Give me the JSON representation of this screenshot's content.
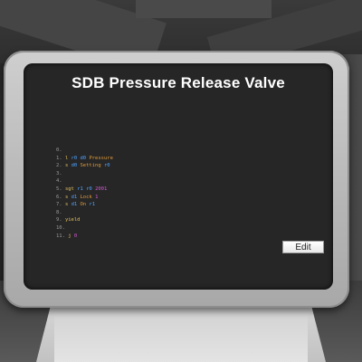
{
  "screen": {
    "title": "SDB Pressure Release Valve",
    "edit_label": "Edit"
  },
  "code": {
    "lines": [
      {
        "tokens": [
          {
            "text": "0.",
            "color": "#9a9a9a"
          }
        ]
      },
      {
        "tokens": [
          {
            "text": "1. ",
            "color": "#9a9a9a"
          },
          {
            "text": "l ",
            "color": "#e0c060"
          },
          {
            "text": "r0 ",
            "color": "#4fa3ff"
          },
          {
            "text": "d0 ",
            "color": "#4fa3ff"
          },
          {
            "text": "Pressure",
            "color": "#e09a3a"
          }
        ]
      },
      {
        "tokens": [
          {
            "text": "2. ",
            "color": "#9a9a9a"
          },
          {
            "text": "s ",
            "color": "#e0c060"
          },
          {
            "text": "d0 ",
            "color": "#4fa3ff"
          },
          {
            "text": "Setting ",
            "color": "#e09a3a"
          },
          {
            "text": "r0",
            "color": "#4fa3ff"
          }
        ]
      },
      {
        "tokens": [
          {
            "text": "3.",
            "color": "#9a9a9a"
          }
        ]
      },
      {
        "tokens": [
          {
            "text": "4.",
            "color": "#9a9a9a"
          }
        ]
      },
      {
        "tokens": [
          {
            "text": "5. ",
            "color": "#9a9a9a"
          },
          {
            "text": "sgt ",
            "color": "#e0c060"
          },
          {
            "text": "r1 ",
            "color": "#4fa3ff"
          },
          {
            "text": "r0 ",
            "color": "#4fa3ff"
          },
          {
            "text": "2001",
            "color": "#d05ad0"
          }
        ]
      },
      {
        "tokens": [
          {
            "text": "6. ",
            "color": "#9a9a9a"
          },
          {
            "text": "s ",
            "color": "#e0c060"
          },
          {
            "text": "d1 ",
            "color": "#4fa3ff"
          },
          {
            "text": "Lock ",
            "color": "#e09a3a"
          },
          {
            "text": "1",
            "color": "#d05ad0"
          }
        ]
      },
      {
        "tokens": [
          {
            "text": "7. ",
            "color": "#9a9a9a"
          },
          {
            "text": "s ",
            "color": "#e0c060"
          },
          {
            "text": "d1 ",
            "color": "#4fa3ff"
          },
          {
            "text": "On ",
            "color": "#e09a3a"
          },
          {
            "text": "r1",
            "color": "#4fa3ff"
          }
        ]
      },
      {
        "tokens": [
          {
            "text": "8.",
            "color": "#9a9a9a"
          }
        ]
      },
      {
        "tokens": [
          {
            "text": "9. ",
            "color": "#9a9a9a"
          },
          {
            "text": "yield",
            "color": "#e0c060"
          }
        ]
      },
      {
        "tokens": [
          {
            "text": "10.",
            "color": "#9a9a9a"
          }
        ]
      },
      {
        "tokens": [
          {
            "text": "11. ",
            "color": "#9a9a9a"
          },
          {
            "text": "j ",
            "color": "#e0c060"
          },
          {
            "text": "0",
            "color": "#d05ad0"
          }
        ]
      }
    ]
  }
}
